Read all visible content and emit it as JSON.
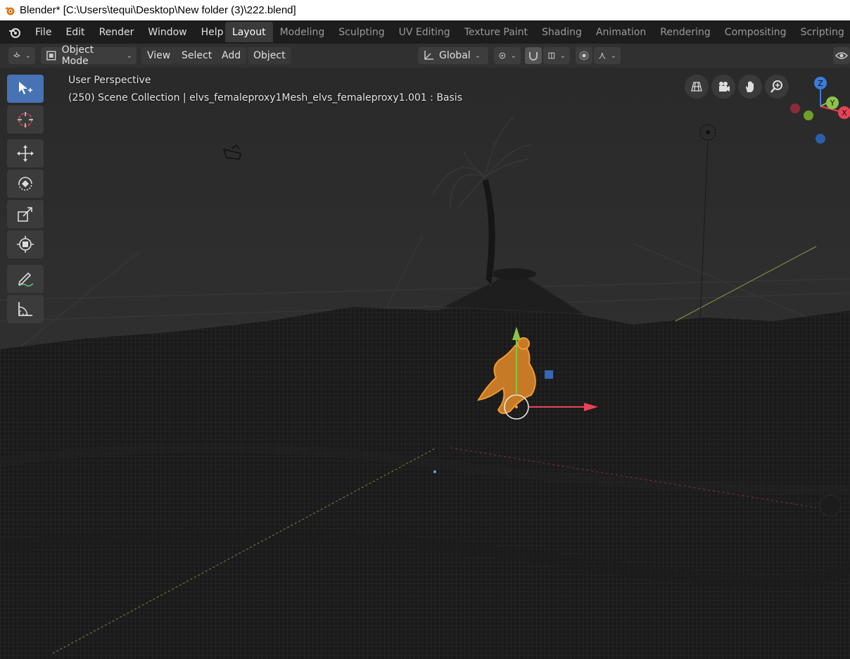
{
  "window": {
    "title": "Blender* [C:\\Users\\tequi\\Desktop\\New folder (3)\\222.blend]"
  },
  "menu": {
    "items": [
      "File",
      "Edit",
      "Render",
      "Window",
      "Help"
    ]
  },
  "workspaces": {
    "tabs": [
      "Layout",
      "Modeling",
      "Sculpting",
      "UV Editing",
      "Texture Paint",
      "Shading",
      "Animation",
      "Rendering",
      "Compositing",
      "Scripting"
    ],
    "active": "Layout"
  },
  "header": {
    "mode": "Object Mode",
    "view": "View",
    "select": "Select",
    "add": "Add",
    "object": "Object",
    "orientation": "Global"
  },
  "viewport": {
    "perspective": "User Perspective",
    "collection_info": "(250) Scene Collection | elvs_femaleproxy1Mesh_elvs_femaleproxy1.001 : Basis",
    "gizmo_axes": [
      "Z",
      "Y",
      "X"
    ]
  },
  "colors": {
    "accent": "#4772b3",
    "selection": "#f29a30",
    "axis_x": "#e84355",
    "axis_y": "#8bc34a",
    "axis_z": "#3d7bd9"
  }
}
